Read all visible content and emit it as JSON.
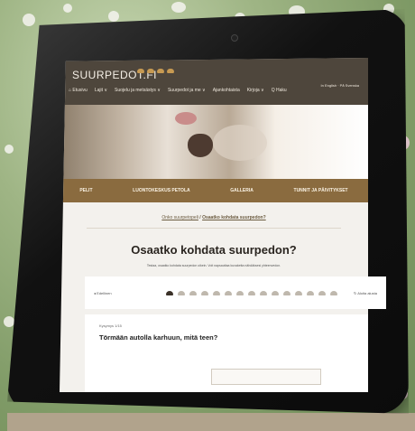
{
  "site": {
    "logo": "SUURPEDOT.FI",
    "nav": [
      "⌂ Etusivu",
      "Lajit ∨",
      "Suojelu ja metsästys ∨",
      "Suurpedot ja me ∨",
      "Ajankohtaista",
      "Kirjoja ∨",
      "Q Haku"
    ],
    "lang": "In English · På Svenska"
  },
  "subnav": [
    "PELIT",
    "LUONTOKESKUS PETOLA",
    "GALLERIA",
    "TUNNIT JA PÄIVITYKSET"
  ],
  "breadcrumb": {
    "parent": "Onko suurpetopeli",
    "sep": " / ",
    "current": "Osaatko kohdata suurpedon?"
  },
  "page": {
    "title": "Osaatko kohdata suurpedon?",
    "intro": "Testaa, osaatko kohdata suurpedon oikein. Voit napsauttaa kuvaketta nähdäksesi yhteenvedon."
  },
  "quiz": {
    "prev": "◂ Edellinen",
    "next": "↻ Aloita alusta",
    "steps_total": 15,
    "current_step": 1,
    "question_count": "Kysymys 1/15",
    "question": "Törmään autolla karhuun, mitä teen?"
  }
}
